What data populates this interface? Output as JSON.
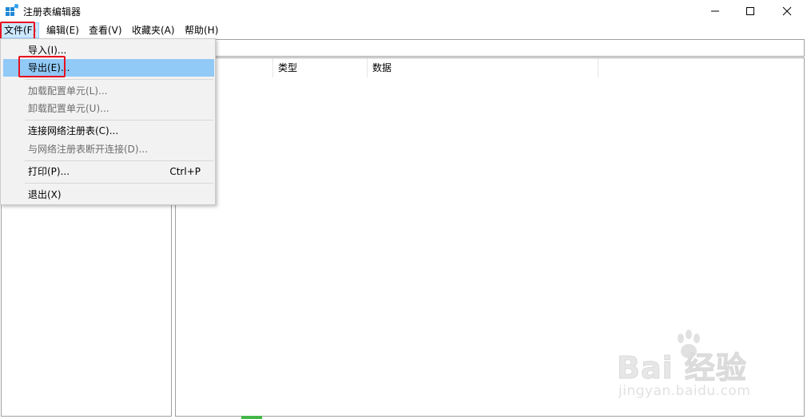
{
  "window": {
    "title": "注册表编辑器",
    "controls": {
      "minimize": "minimize-icon",
      "maximize": "maximize-icon",
      "close": "close-icon"
    }
  },
  "menubar": {
    "items": [
      {
        "label": "文件(F)"
      },
      {
        "label": "编辑(E)"
      },
      {
        "label": "查看(V)"
      },
      {
        "label": "收藏夹(A)"
      },
      {
        "label": "帮助(H)"
      }
    ]
  },
  "file_menu": {
    "items": [
      {
        "label": "导入(I)...",
        "enabled": true
      },
      {
        "label": "导出(E)...",
        "enabled": true,
        "selected": true
      },
      {
        "label": "加载配置单元(L)...",
        "enabled": false
      },
      {
        "label": "卸载配置单元(U)...",
        "enabled": false
      },
      {
        "label": "连接网络注册表(C)...",
        "enabled": true
      },
      {
        "label": "与网络注册表断开连接(D)...",
        "enabled": false
      },
      {
        "label": "打印(P)...",
        "enabled": true,
        "shortcut": "Ctrl+P"
      },
      {
        "label": "退出(X)",
        "enabled": true
      }
    ]
  },
  "list_view": {
    "columns": [
      "",
      "类型",
      "数据"
    ]
  },
  "watermark": {
    "brand": "Bai 经验",
    "url": "jingyan.baidu.com"
  },
  "colors": {
    "menu_selected": "#91c9f7",
    "annotation": "#e8101f",
    "menu_background": "#f2f2f2"
  }
}
